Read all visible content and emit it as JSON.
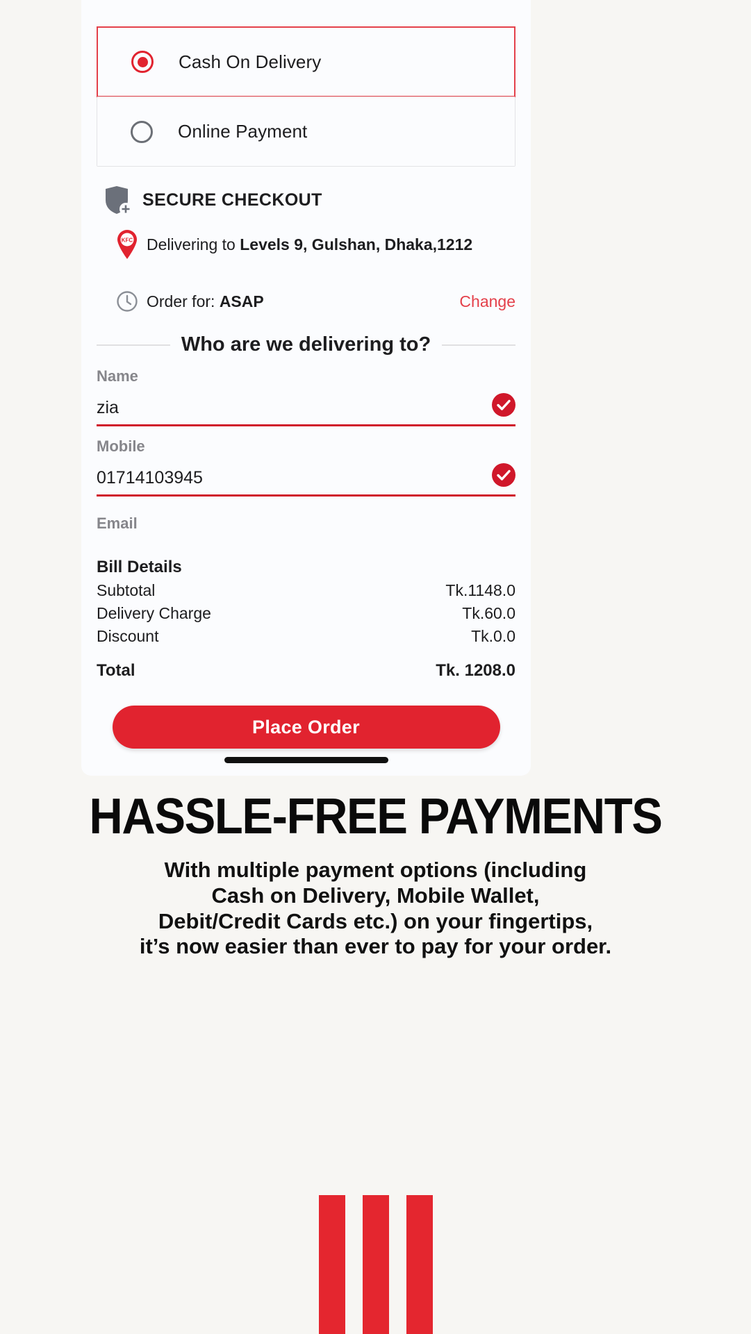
{
  "payment_options": [
    {
      "label": "Cash On Delivery",
      "selected": true,
      "icon": "radio-selected-icon"
    },
    {
      "label": "Online Payment",
      "selected": false,
      "icon": "radio-unselected-icon"
    }
  ],
  "secure": {
    "title": "SECURE CHECKOUT",
    "icon": "shield-plus-icon"
  },
  "delivery": {
    "prefix": "Delivering to ",
    "address": "Levels 9, Gulshan, Dhaka,1212",
    "icon": "kfc-map-pin-icon"
  },
  "order_time": {
    "prefix": "Order for: ",
    "value": "ASAP",
    "change_label": "Change",
    "icon": "clock-icon"
  },
  "form": {
    "heading": "Who are we delivering to?",
    "fields": [
      {
        "label": "Name",
        "value": "zia",
        "valid": true
      },
      {
        "label": "Mobile",
        "value": "01714103945",
        "valid": true
      },
      {
        "label": "Email",
        "value": "",
        "valid": false
      }
    ]
  },
  "bill": {
    "title": "Bill Details",
    "rows": [
      {
        "label": "Subtotal",
        "amount": "Tk.1148.0"
      },
      {
        "label": "Delivery Charge",
        "amount": "Tk.60.0"
      },
      {
        "label": "Discount",
        "amount": "Tk.0.0"
      }
    ],
    "total": {
      "label": "Total",
      "amount": "Tk. 1208.0"
    }
  },
  "cta": {
    "label": "Place Order"
  },
  "promo": {
    "headline": "HASSLE-FREE PAYMENTS",
    "body_lines": [
      "With multiple payment options (including",
      "Cash on Delivery, Mobile Wallet,",
      "Debit/Credit Cards etc.) on your fingertips,",
      "it’s now easier than ever to pay for your order."
    ]
  },
  "colors": {
    "brand_red": "#e1232f",
    "accent_red": "#e4404a",
    "check_red": "#d0172a",
    "bar_red": "#e4262f",
    "page_bg": "#f7f6f3",
    "phone_bg": "#fbfcfe",
    "label_gray": "#86868b"
  }
}
